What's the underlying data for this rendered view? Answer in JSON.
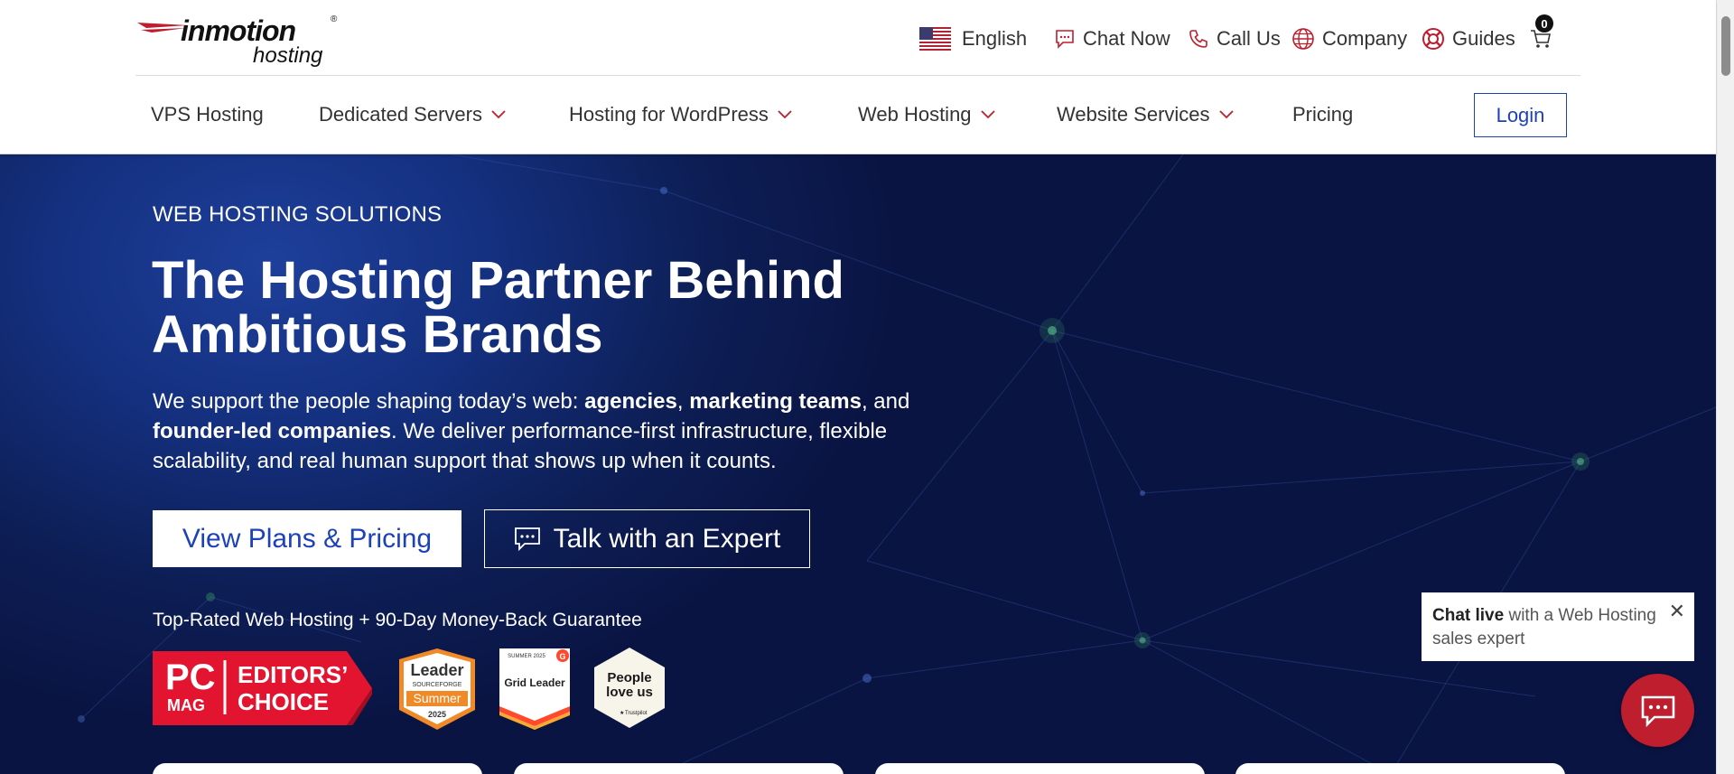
{
  "logo": {
    "brand": "inmotion",
    "sub": "hosting",
    "reg": "®"
  },
  "utility": {
    "language": "English",
    "chat": "Chat Now",
    "call": "Call Us",
    "company": "Company",
    "guides": "Guides",
    "cart_count": "0"
  },
  "nav": {
    "items": [
      {
        "label": "VPS Hosting"
      },
      {
        "label": "Dedicated Servers"
      },
      {
        "label": "Hosting for WordPress"
      },
      {
        "label": "Web Hosting"
      },
      {
        "label": "Website Services"
      },
      {
        "label": "Pricing"
      }
    ],
    "login": "Login"
  },
  "hero": {
    "eyebrow": "WEB HOSTING SOLUTIONS",
    "headline": "The Hosting Partner Behind Ambitious Brands",
    "lede_1": "We support the people shaping today’s web: ",
    "lede_b1": "agencies",
    "lede_2": ", ",
    "lede_b2": "marketing teams",
    "lede_3": ", and ",
    "lede_b3": "founder-led companies",
    "lede_4": ". We deliver performance-first infrastructure, flexible scalability, and real human support that shows up when it counts.",
    "cta_primary": "View Plans & Pricing",
    "cta_secondary": "Talk with an Expert",
    "guarantee": "Top-Rated Web Hosting + 90-Day Money-Back Guarantee"
  },
  "badges": {
    "pcmag_pc": "PC",
    "pcmag_mag": "MAG",
    "pcmag_line1": "EDITORS’",
    "pcmag_line2": "CHOICE",
    "sf_title": "Leader",
    "sf_brand": "SOURCEFORGE",
    "sf_season": "Summer",
    "sf_year": "2025",
    "g2_top": "SUMMER 2025",
    "g2_label": "Grid Leader",
    "tp_line1": "People",
    "tp_line2": "love us",
    "tp_brand": "Trustpilot"
  },
  "chat_widget": {
    "bold": "Chat live",
    "rest": " with a Web Hosting sales expert"
  },
  "colors": {
    "accent": "#be1e2d",
    "link_blue": "#1d41b8",
    "hero_dark": "#0a1443"
  }
}
